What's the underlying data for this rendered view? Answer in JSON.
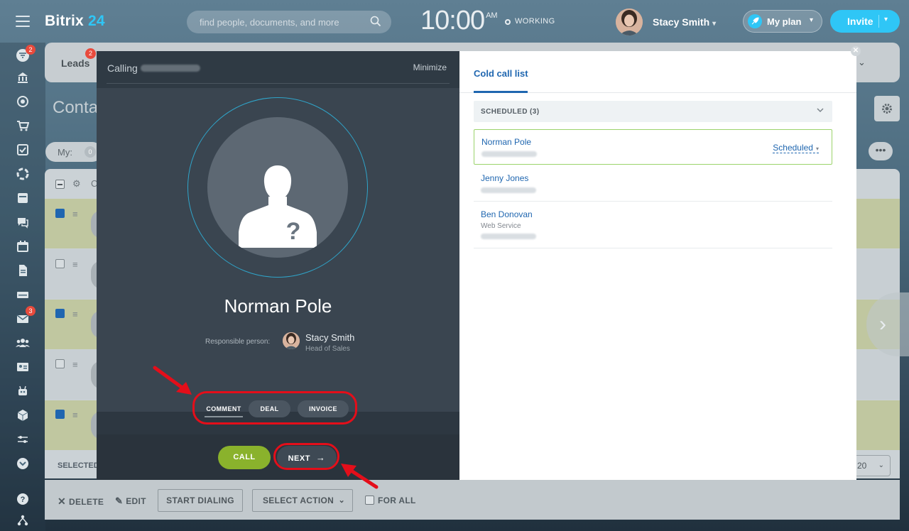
{
  "header": {
    "logo_main": "Bitrix",
    "logo_num": "24",
    "search_placeholder": "find people, documents, and more",
    "time": "10:00",
    "ampm": "AM",
    "working": "WORKING",
    "user_name": "Stacy Smith",
    "my_plan": "My plan",
    "invite": "Invite"
  },
  "sidebar": {
    "badges": [
      "2",
      "3"
    ]
  },
  "background": {
    "leads_label": "Leads",
    "leads_badge": "2",
    "page_title_partial": "Conta",
    "filter_label": "My:",
    "filter_count": "0",
    "selected_label": "SELECTED",
    "page_size": "20",
    "toolbar": {
      "delete": "DELETE",
      "edit": "EDIT",
      "start_dialing": "START DIALING",
      "select_action": "SELECT ACTION",
      "for_all": "FOR ALL"
    }
  },
  "call_dialog": {
    "calling_label": "Calling",
    "minimize": "Minimize",
    "contact_name": "Norman Pole",
    "responsible_label": "Responsible person:",
    "responsible_name": "Stacy Smith",
    "responsible_role": "Head of Sales",
    "tabs": [
      {
        "label": "COMMENT"
      },
      {
        "label": "DEAL"
      },
      {
        "label": "INVOICE"
      }
    ],
    "call_button": "CALL",
    "next_button": "NEXT"
  },
  "cold_call_list": {
    "tab_title": "Cold call list",
    "group_header": "SCHEDULED (3)",
    "items": [
      {
        "name": "Norman Pole",
        "status": "Scheduled"
      },
      {
        "name": "Jenny Jones"
      },
      {
        "name": "Ben Donovan",
        "company": "Web Service"
      }
    ]
  },
  "colors": {
    "accent_blue": "#2fc6f6",
    "link_blue": "#2067b0",
    "call_green": "#8ab22c",
    "annotation_red": "#e40e1a"
  }
}
